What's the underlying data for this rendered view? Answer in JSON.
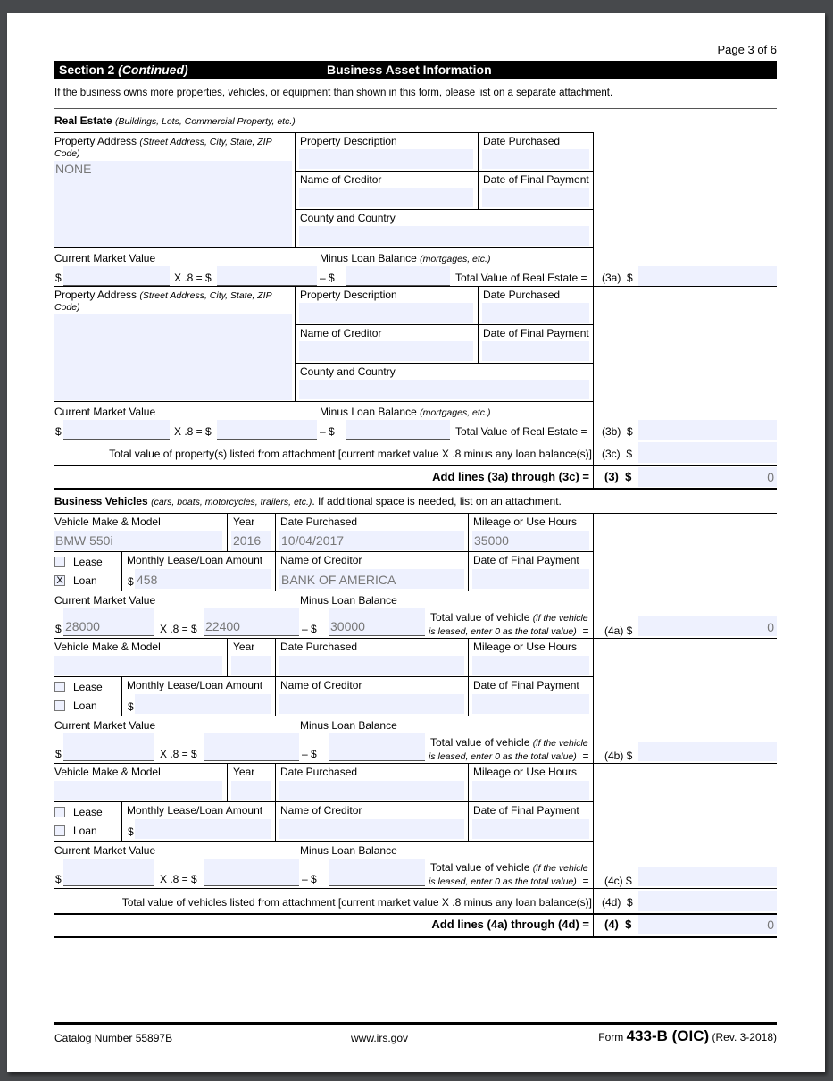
{
  "page_label": "Page 3 of 6",
  "header": {
    "section": "Section 2",
    "continued": "(Continued)",
    "title": "Business Asset Information"
  },
  "intro": "If the business owns more properties, vehicles, or equipment than shown in this form, please list on a separate attachment.",
  "real_estate": {
    "heading": "Real Estate",
    "heading_note": "(Buildings, Lots, Commercial Property, etc.)",
    "labels": {
      "address": "Property Address",
      "address_note": "(Street Address, City, State, ZIP",
      "address_note2": "Code)",
      "description": "Property Description",
      "date_purchased": "Date Purchased",
      "creditor": "Name of Creditor",
      "final_payment": "Date of Final Payment",
      "county": "County and Country",
      "cmv": "Current Market Value",
      "minus_loan": "Minus Loan Balance",
      "minus_loan_note": "(mortgages, etc.)",
      "dollar": "$",
      "times": "X .8 =  $",
      "minus": "–  $",
      "total": "Total Value of Real Estate ="
    },
    "properties": [
      {
        "line": "(3a)",
        "address": "NONE",
        "description": "",
        "date_purchased": "",
        "creditor": "",
        "final_payment": "",
        "county": "",
        "cmv": "",
        "times_value": "",
        "loan_balance": "",
        "total": ""
      },
      {
        "line": "(3b)",
        "address": "",
        "description": "",
        "date_purchased": "",
        "creditor": "",
        "final_payment": "",
        "county": "",
        "cmv": "",
        "times_value": "",
        "loan_balance": "",
        "total": ""
      }
    ],
    "attachment_label": "Total value of property(s) listed from attachment [current market value X .8  minus any loan balance(s)]",
    "attachment_line": "(3c)",
    "attachment_value": "",
    "sum_label": "Add lines (3a) through (3c) =",
    "sum_line": "(3)",
    "sum_value": "0"
  },
  "vehicles": {
    "heading": "Business Vehicles",
    "heading_note": "(cars, boats, motorcycles, trailers, etc.)",
    "heading_tail": ". If additional space is needed, list on an attachment.",
    "labels": {
      "make": "Vehicle Make & Model",
      "year": "Year",
      "date_purchased": "Date Purchased",
      "mileage": "Mileage or Use Hours",
      "lease": "Lease",
      "loan": "Loan",
      "monthly": "Monthly Lease/Loan Amount",
      "creditor": "Name of Creditor",
      "final_payment": "Date of Final Payment",
      "cmv": "Current Market Value",
      "minus_loan": "Minus Loan Balance",
      "dollar": "$",
      "times": "X .8 =  $",
      "minus": "–  $",
      "total": "Total value of vehicle",
      "total_note": "(if the vehicle",
      "total_note2": "is leased, enter 0 as the total value)",
      "eq": "="
    },
    "items": [
      {
        "line": "(4a) $",
        "make": "BMW 550i",
        "year": "2016",
        "date_purchased": "10/04/2017",
        "mileage": "35000",
        "lease_checked": "",
        "loan_checked": "X",
        "monthly": "458",
        "creditor": "BANK OF AMERICA",
        "final_payment": "",
        "cmv": "28000",
        "times_value": "22400",
        "loan_balance": "30000",
        "total": "0"
      },
      {
        "line": "(4b) $",
        "make": "",
        "year": "",
        "date_purchased": "",
        "mileage": "",
        "lease_checked": "",
        "loan_checked": "",
        "monthly": "",
        "creditor": "",
        "final_payment": "",
        "cmv": "",
        "times_value": "",
        "loan_balance": "",
        "total": ""
      },
      {
        "line": "(4c) $",
        "make": "",
        "year": "",
        "date_purchased": "",
        "mileage": "",
        "lease_checked": "",
        "loan_checked": "",
        "monthly": "",
        "creditor": "",
        "final_payment": "",
        "cmv": "",
        "times_value": "",
        "loan_balance": "",
        "total": ""
      }
    ],
    "attachment_label": "Total value of vehicles listed from attachment [current market value X .8 minus any loan balance(s)]",
    "attachment_line": "(4d)",
    "attachment_value": "",
    "sum_label": "Add lines (4a) through (4d) =",
    "sum_line": "(4)",
    "sum_value": "0"
  },
  "footer": {
    "catalog": "Catalog Number 55897B",
    "website": "www.irs.gov",
    "form_prefix": "Form",
    "form_number": "433-B (OIC)",
    "revision": "(Rev. 3-2018)"
  }
}
